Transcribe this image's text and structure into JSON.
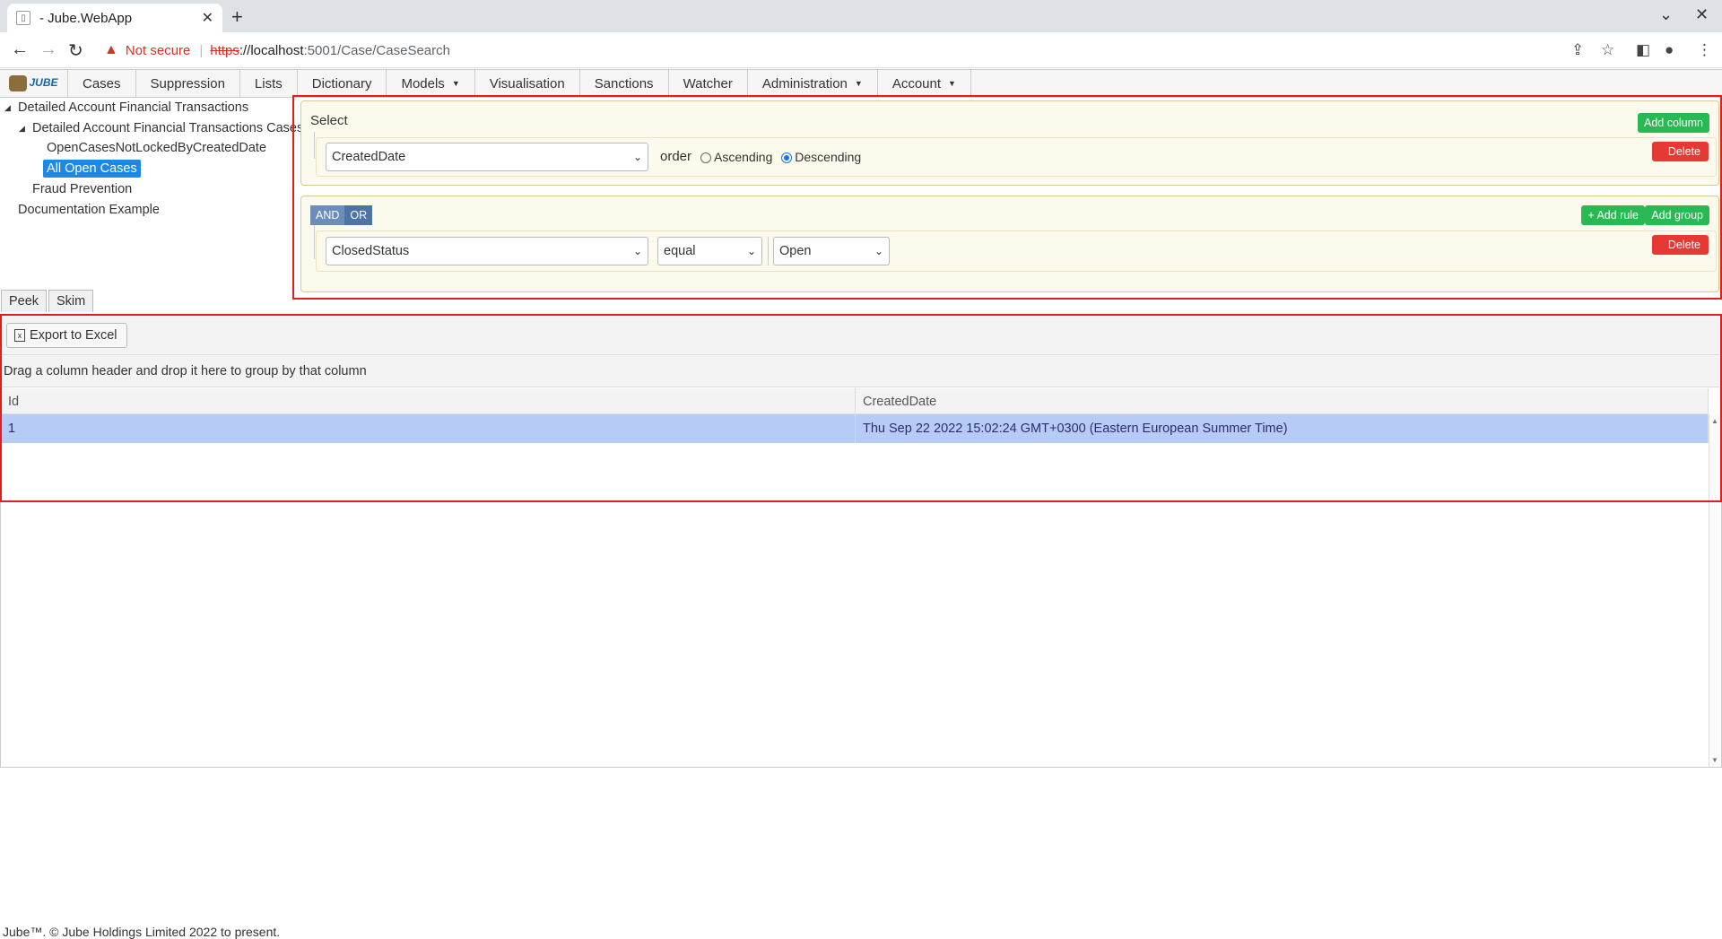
{
  "browser": {
    "tab_title": "- Jube.WebApp",
    "not_secure": "Not secure",
    "url_scheme": "https",
    "url_host": "://localhost",
    "url_path": ":5001/Case/CaseSearch"
  },
  "nav": {
    "logo_text": "JUBE",
    "items": [
      {
        "label": "Cases",
        "dropdown": false
      },
      {
        "label": "Suppression",
        "dropdown": false
      },
      {
        "label": "Lists",
        "dropdown": false
      },
      {
        "label": "Dictionary",
        "dropdown": false
      },
      {
        "label": "Models",
        "dropdown": true
      },
      {
        "label": "Visualisation",
        "dropdown": false
      },
      {
        "label": "Sanctions",
        "dropdown": false
      },
      {
        "label": "Watcher",
        "dropdown": false
      },
      {
        "label": "Administration",
        "dropdown": true
      },
      {
        "label": "Account",
        "dropdown": true
      }
    ]
  },
  "tree": {
    "root": "Detailed Account Financial Transactions",
    "child": "Detailed Account Financial Transactions Cases",
    "leaf_1": "OpenCasesNotLockedByCreatedDate",
    "leaf_2": "All Open Cases",
    "item_fraud": "Fraud Prevention",
    "item_doc": "Documentation Example"
  },
  "select_group": {
    "label": "Select",
    "add_column": "Add column",
    "column": "CreatedDate",
    "order_label": "order",
    "ascending": "Ascending",
    "descending": "Descending",
    "order_selected": "Descending",
    "delete": "Delete"
  },
  "filter_group": {
    "and": "AND",
    "or": "OR",
    "add_rule": "+ Add rule",
    "add_group": "Add group",
    "field": "ClosedStatus",
    "operator": "equal",
    "value": "Open",
    "delete": "Delete"
  },
  "subtabs": {
    "peek": "Peek",
    "skim": "Skim"
  },
  "grid": {
    "export": "Export to Excel",
    "group_hint": "Drag a column header and drop it here to group by that column",
    "columns": [
      "Id",
      "CreatedDate"
    ],
    "rows": [
      [
        "1",
        "Thu Sep 22 2022 15:02:24 GMT+0300 (Eastern European Summer Time)"
      ]
    ]
  },
  "footer": "Jube™. © Jube Holdings Limited 2022 to present."
}
